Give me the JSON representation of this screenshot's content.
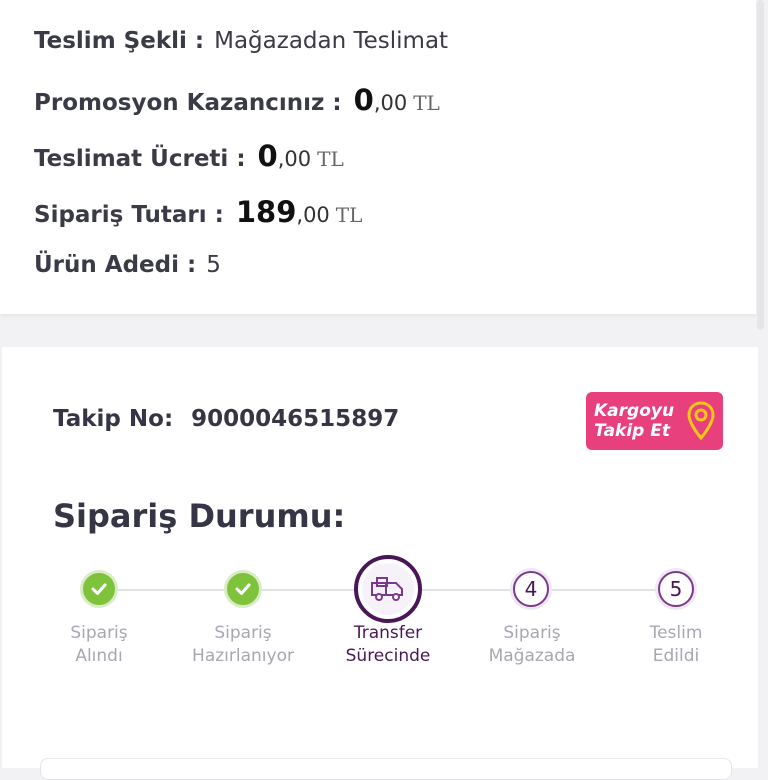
{
  "summary": {
    "delivery_method": {
      "label": "Teslim Şekli :",
      "value": "Mağazadan Teslimat"
    },
    "promotion": {
      "label": "Promosyon Kazancınız :",
      "amount": "0",
      "decimal": ",00",
      "currency": "TL"
    },
    "delivery_fee": {
      "label": "Teslimat Ücreti :",
      "amount": "0",
      "decimal": ",00",
      "currency": "TL"
    },
    "order_total": {
      "label": "Sipariş Tutarı :",
      "amount": "189",
      "decimal": ",00",
      "currency": "TL"
    },
    "item_count": {
      "label": "Ürün Adedi :",
      "value": "5"
    }
  },
  "tracking": {
    "label": "Takip No:",
    "number": "9000046515897",
    "button_line1": "Kargoyu",
    "button_line2": "Takip Et",
    "button_icon": "location-pin-icon"
  },
  "order_status": {
    "title": "Sipariş Durumu:",
    "steps": [
      {
        "line1": "Sipariş",
        "line2": "Alındı",
        "state": "done"
      },
      {
        "line1": "Sipariş",
        "line2": "Hazırlanıyor",
        "state": "done"
      },
      {
        "line1": "Transfer",
        "line2": "Sürecinde",
        "state": "current",
        "icon": "truck-icon"
      },
      {
        "line1": "Sipariş",
        "line2": "Mağazada",
        "state": "pending",
        "number": "4"
      },
      {
        "line1": "Teslim",
        "line2": "Edildi",
        "state": "pending",
        "number": "5"
      }
    ]
  },
  "colors": {
    "done_green": "#7fc23b",
    "brand_purple": "#4a1656",
    "button_pink": "#e8407d",
    "pin_yellow": "#f5c518"
  }
}
